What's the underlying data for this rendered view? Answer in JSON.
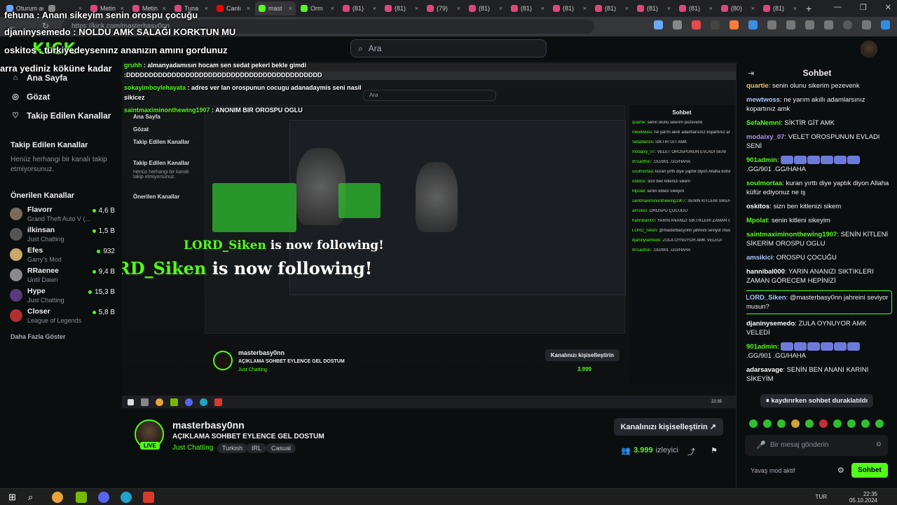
{
  "browser": {
    "tabs": [
      {
        "label": "Oturum aç",
        "color": "#6aa9ff"
      },
      {
        "label": "",
        "color": "#888"
      },
      {
        "label": "Metin",
        "color": "#e0457b"
      },
      {
        "label": "Metin",
        "color": "#e0457b"
      },
      {
        "label": "Tuna",
        "color": "#e0457b"
      },
      {
        "label": "Canlı",
        "color": "#ff0000"
      },
      {
        "label": "mast",
        "color": "#53fc18"
      },
      {
        "label": "Orm",
        "color": "#53fc18"
      },
      {
        "label": "(81)",
        "color": "#e0457b"
      },
      {
        "label": "(81)",
        "color": "#e0457b"
      },
      {
        "label": "(79)",
        "color": "#e0457b"
      },
      {
        "label": "(81)",
        "color": "#e0457b"
      },
      {
        "label": "(81)",
        "color": "#e0457b"
      },
      {
        "label": "(81)",
        "color": "#e0457b"
      },
      {
        "label": "(81)",
        "color": "#e0457b"
      },
      {
        "label": "(81)",
        "color": "#e0457b"
      },
      {
        "label": "(81)",
        "color": "#e0457b"
      },
      {
        "label": "(80)",
        "color": "#e0457b"
      },
      {
        "label": "(81)",
        "color": "#e0457b"
      }
    ],
    "url": "https://kick.com/masterbasy0nn"
  },
  "header": {
    "logo": "KICK",
    "search_placeholder": "Ara"
  },
  "sidebar": {
    "nav": [
      {
        "label": "Ana Sayfa",
        "icon": "home-icon"
      },
      {
        "label": "Gözat",
        "icon": "compass-icon"
      },
      {
        "label": "Takip Edilen Kanallar",
        "icon": "heart-icon"
      }
    ],
    "followed_title": "Takip Edilen Kanallar",
    "followed_empty": "Henüz herhangi bir kanalı takip etmiyorsunuz.",
    "recommended_title": "Önerilen Kanallar",
    "channels": [
      {
        "name": "Flavorr",
        "game": "Grand Theft Auto V (...",
        "viewers": "4,6 B",
        "color": "#7a6a5a"
      },
      {
        "name": "ilkinsan",
        "game": "Just Chatting",
        "viewers": "1,5 B",
        "color": "#555"
      },
      {
        "name": "Efes",
        "game": "Garry's Mod",
        "viewers": "932",
        "color": "#c9a86a"
      },
      {
        "name": "RRaenee",
        "game": "Until Dawn",
        "viewers": "9,4 B",
        "color": "#8a8a8a"
      },
      {
        "name": "Hype",
        "game": "Just Chatting",
        "viewers": "15,3 B",
        "color": "#5a3a7a"
      },
      {
        "name": "Closer",
        "game": "League of Legends",
        "viewers": "5,8 B",
        "color": "#b03030"
      }
    ],
    "more": "Daha Fazla Göster"
  },
  "overlay": {
    "lines": [
      {
        "user": "fehuna",
        "text": "Ananı sikeyim senin orospu çocuğu"
      },
      {
        "user": "djaninysemedo",
        "text": "NOLDU AMK SALAĞI KORKTUN MU"
      },
      {
        "user": "oskitos",
        "text": "türkiyedeysenınz ananızın amını gordunuz"
      },
      {
        "user": "",
        "text": "arra yediniz köküne kadar"
      }
    ],
    "inner_lines": [
      {
        "user": "gruhh",
        "text": "almanyadamısın hocam sen sedat pekeri bekle gimdi"
      },
      {
        "user": "",
        "text": ":DDDDDDDDDDDDDDDDDDDDDDDDDDDDDDDDDDDDDDDDDDD"
      },
      {
        "user": "sokayimboylehayata",
        "text": "adres ver lan orospunun cocugu adanadaymis seni nasil"
      },
      {
        "user": "",
        "text": "sikicez"
      },
      {
        "user": "saintmaximinonthewing1907",
        "text": "ANONIM BIR OROSPU OGLU"
      }
    ],
    "follow_name": "LORD_Siken",
    "follow_text": "is now following!"
  },
  "stream": {
    "streamer": "masterbasy0nn",
    "live_badge": "LIVE",
    "title": "AÇIKLAMA SOHBET EYLENCE GEL DOSTUM",
    "category": "Just Chatting",
    "tags": [
      "Turkish",
      "IRL",
      "Casual"
    ],
    "customize_button": "Kanalınızı kişiselleştirin",
    "viewers": "3.999",
    "viewers_label": "izleyici"
  },
  "chat": {
    "title": "Sohbet",
    "messages": [
      {
        "user": "quartie",
        "text": "senin olunu sikerim pezevenk",
        "color": "#e8c26a"
      },
      {
        "user": "mewtwoss",
        "text": "ne yarım akıllı adamlarsınız kopartınız amk",
        "color": "#a7c7ff"
      },
      {
        "user": "SefaNemni",
        "text": "SİKTİR GİT AMK",
        "color": "#53fc18"
      },
      {
        "user": "modaixy_07",
        "text": "VELET OROSPUNUN EVLADI SENİ",
        "color": "#b392f0"
      },
      {
        "user": "901admin",
        "text": ".GG/901 .GG/HAHA",
        "color": "#53fc18",
        "emotes": 6
      },
      {
        "user": "soulmortaa",
        "text": "kuran yırttı diye yaptık diyon Allaha küfür ediyonuz ne iş",
        "color": "#53fc18"
      },
      {
        "user": "oskitos",
        "text": "sizn ben kitlenizi sikem",
        "color": "#ffffff"
      },
      {
        "user": "Mpolat",
        "text": "senin kitleni sikeyim",
        "color": "#53fc18"
      },
      {
        "user": "saintmaximinonthewing1907",
        "text": "SENİN KİTLENİ SİKERİM OROSPU OGLU",
        "color": "#53fc18"
      },
      {
        "user": "amsikici",
        "text": "OROSPU ÇOCUĞU",
        "color": "#a7c7ff"
      },
      {
        "user": "hannibal000",
        "text": "YARIN ANANIZI SIKTIKLERI ZAMAN GÖRECEM HEPİNİZİ",
        "color": "#ffffff"
      },
      {
        "user": "LORD_Siken",
        "text": "@masterbasy0nn jahreini seviyor musun?",
        "color": "#a7c7ff",
        "highlight": true
      },
      {
        "user": "djaninysemedo",
        "text": "ZULA OYNUYOR AMK VELEDİ",
        "color": "#ffffff"
      },
      {
        "user": "901admin",
        "text": ".GG/901 .GG/HAHA",
        "color": "#53fc18",
        "emotes": 6
      },
      {
        "user": "adarsavage",
        "text": "SENİN BEN ANANI KARINI SİKEYİM",
        "color": "#ffffff"
      }
    ],
    "paused": "kaydırırken sohbet duraklatıldı",
    "input_placeholder": "Bir mesaj gönderin",
    "slow_mode": "Yavaş mod aktif",
    "send": "Sohbet"
  },
  "taskbar": {
    "lang": "TUR",
    "time": "22:35",
    "date": "05.10.2024"
  }
}
